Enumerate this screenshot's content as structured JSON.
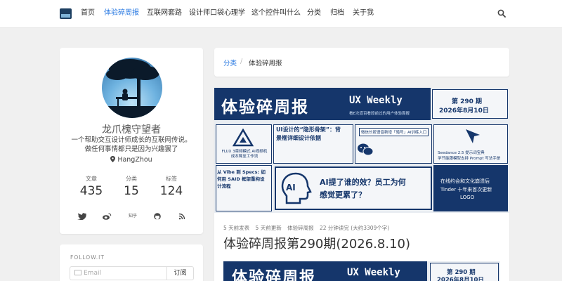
{
  "nav": {
    "items": [
      {
        "label": "首页",
        "active": false
      },
      {
        "label": "体验碎周报",
        "active": true
      },
      {
        "label": "互联网套路",
        "active": false
      },
      {
        "label": "设计师口袋心理学",
        "active": false
      },
      {
        "label": "这个控件叫什么",
        "active": false
      },
      {
        "label": "分类",
        "active": false
      },
      {
        "label": "归档",
        "active": false
      },
      {
        "label": "关于我",
        "active": false
      }
    ],
    "search_icon": "search-icon",
    "accent": "#2a7ae2"
  },
  "profile": {
    "name": "龙爪槐守望者",
    "bio_line1": "一个帮助交互设计师成长的互联网传说。",
    "bio_line2": "做任何事情都只是因为兴趣罢了",
    "location": "HangZhou",
    "stats": [
      {
        "label": "文章",
        "value": "435"
      },
      {
        "label": "分类",
        "value": "15"
      },
      {
        "label": "标签",
        "value": "124"
      }
    ],
    "social": [
      "twitter-icon",
      "weibo-icon",
      "zhihu-icon",
      "github-icon",
      "rss-icon"
    ],
    "zhihu_text": "知乎"
  },
  "follow": {
    "title": "FOLLOW.IT",
    "placeholder": "Email",
    "button": "订阅"
  },
  "breadcrumb": {
    "parent": "分类",
    "separator": "/",
    "current": "体验碎周报"
  },
  "banner": {
    "title": "体验碎周报",
    "weekly": "UX Weekly",
    "subtitle": "看E次道百看段前过的用户体验周报",
    "issue": "第 290 期",
    "date": "2026年8月10日",
    "article1": "FLUX 3章频模式 AI视频机成本降至工作流",
    "article2_l1": "UI设计的“隐形骨架”：背",
    "article2_l2": "景框详细设计依据",
    "article3": "微信长按语音新增「暗号」AI训练入口",
    "article4_l1": "Seedance 2.5 提示词宝典",
    "article4_l2": "学节能跟模型支持 Prompt 写法手册",
    "article5_l1": "从 Vibe 到 Specs: 如",
    "article5_l2": "何用 SAID 框架重构设",
    "article5_l3": "计流程",
    "article6_l1": "AI提了谁的效？员工为何",
    "article6_l2": "感觉更累了？",
    "article7_l1": "在线约会和文化崩溃后",
    "article7_l2": "Tinder 十年来首次更新",
    "article7_l3": "LOGO",
    "ai_badge": "AI"
  },
  "post": {
    "meta": [
      "5 天前发表",
      "5 天前更新",
      "体验碎周报",
      "22 分钟读完 (大约3309个字)"
    ],
    "title": "体验碎周报第290期(2026.8.10)"
  },
  "colors": {
    "brand_navy": "#15366b",
    "accent_blue": "#2a7ae2",
    "background": "#f0f0f0"
  }
}
